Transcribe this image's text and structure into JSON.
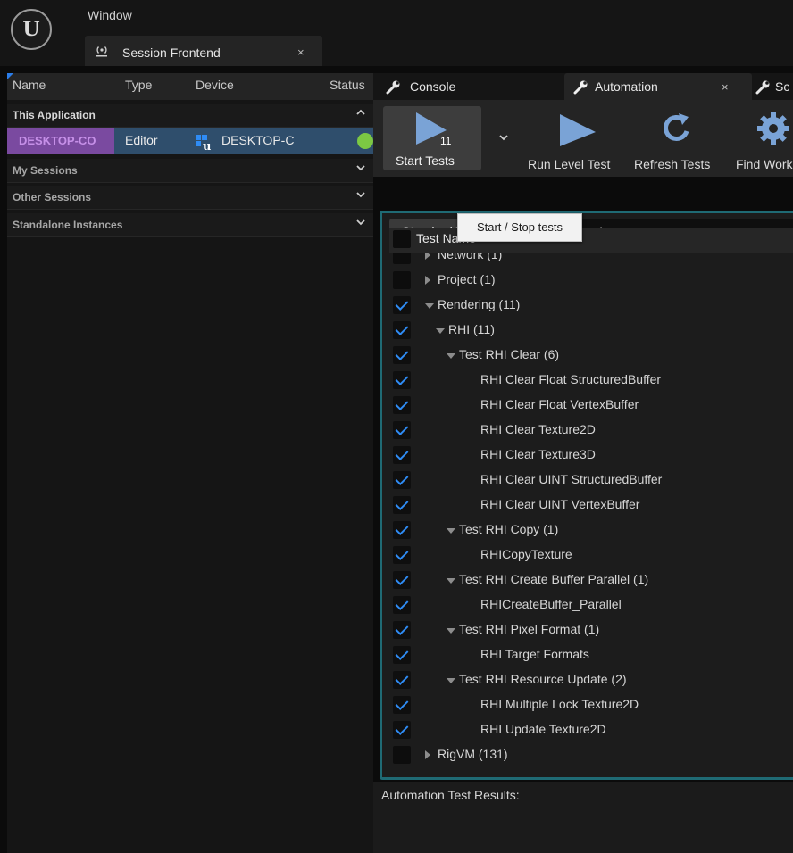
{
  "window": {
    "menu_window": "Window",
    "tab_title": "Session Frontend",
    "tab_close": "×"
  },
  "sessions": {
    "columns": {
      "name": "Name",
      "type": "Type",
      "device": "Device",
      "status": "Status"
    },
    "this_application": "This Application",
    "session": {
      "name": "DESKTOP-CO",
      "type": "Editor",
      "device": "DESKTOP-C",
      "status_color": "#7cc843"
    },
    "my_sessions": "My Sessions",
    "other_sessions": "Other Sessions",
    "standalone_instances": "Standalone Instances",
    "chevron_up": "⌃",
    "chevron_down": "⌄"
  },
  "tabs": {
    "console": "Console",
    "automation": "Automation",
    "automation_close": "×",
    "more": "Sc"
  },
  "toolbar": {
    "start_count": "11",
    "start_label": "Start Tests",
    "dropdown": "⌄",
    "run_label": "Run Level Test",
    "refresh_label": "Refresh Tests",
    "find_label": "Find Worker",
    "tooltip": "Start / Stop tests"
  },
  "tests": {
    "filter": "Standard Tests",
    "search_placeholder": "arch",
    "header": "Test Name",
    "rows": [
      {
        "label": "Network (1)",
        "checked": false,
        "level": 0,
        "arrow": "closed"
      },
      {
        "label": "Project (1)",
        "checked": false,
        "level": 0,
        "arrow": "closed"
      },
      {
        "label": "Rendering (11)",
        "checked": true,
        "level": 0,
        "arrow": "open"
      },
      {
        "label": "RHI (11)",
        "checked": true,
        "level": 1,
        "arrow": "open"
      },
      {
        "label": "Test RHI Clear (6)",
        "checked": true,
        "level": 2,
        "arrow": "open"
      },
      {
        "label": "RHI Clear Float StructuredBuffer",
        "checked": true,
        "level": 3,
        "arrow": "none"
      },
      {
        "label": "RHI Clear Float VertexBuffer",
        "checked": true,
        "level": 3,
        "arrow": "none"
      },
      {
        "label": "RHI Clear Texture2D",
        "checked": true,
        "level": 3,
        "arrow": "none"
      },
      {
        "label": "RHI Clear Texture3D",
        "checked": true,
        "level": 3,
        "arrow": "none"
      },
      {
        "label": "RHI Clear UINT StructuredBuffer",
        "checked": true,
        "level": 3,
        "arrow": "none"
      },
      {
        "label": "RHI Clear UINT VertexBuffer",
        "checked": true,
        "level": 3,
        "arrow": "none"
      },
      {
        "label": "Test RHI Copy (1)",
        "checked": true,
        "level": 2,
        "arrow": "open"
      },
      {
        "label": "RHICopyTexture",
        "checked": true,
        "level": 3,
        "arrow": "none"
      },
      {
        "label": "Test RHI Create Buffer Parallel (1)",
        "checked": true,
        "level": 2,
        "arrow": "open"
      },
      {
        "label": "RHICreateBuffer_Parallel",
        "checked": true,
        "level": 3,
        "arrow": "none"
      },
      {
        "label": "Test RHI Pixel Format (1)",
        "checked": true,
        "level": 2,
        "arrow": "open"
      },
      {
        "label": "RHI Target Formats",
        "checked": true,
        "level": 3,
        "arrow": "none"
      },
      {
        "label": "Test RHI Resource Update (2)",
        "checked": true,
        "level": 2,
        "arrow": "open"
      },
      {
        "label": "RHI Multiple Lock Texture2D",
        "checked": true,
        "level": 3,
        "arrow": "none"
      },
      {
        "label": "RHI Update Texture2D",
        "checked": true,
        "level": 3,
        "arrow": "none"
      },
      {
        "label": "RigVM (131)",
        "checked": false,
        "level": 0,
        "arrow": "closed"
      }
    ]
  },
  "results": {
    "label": "Automation Test Results:"
  }
}
